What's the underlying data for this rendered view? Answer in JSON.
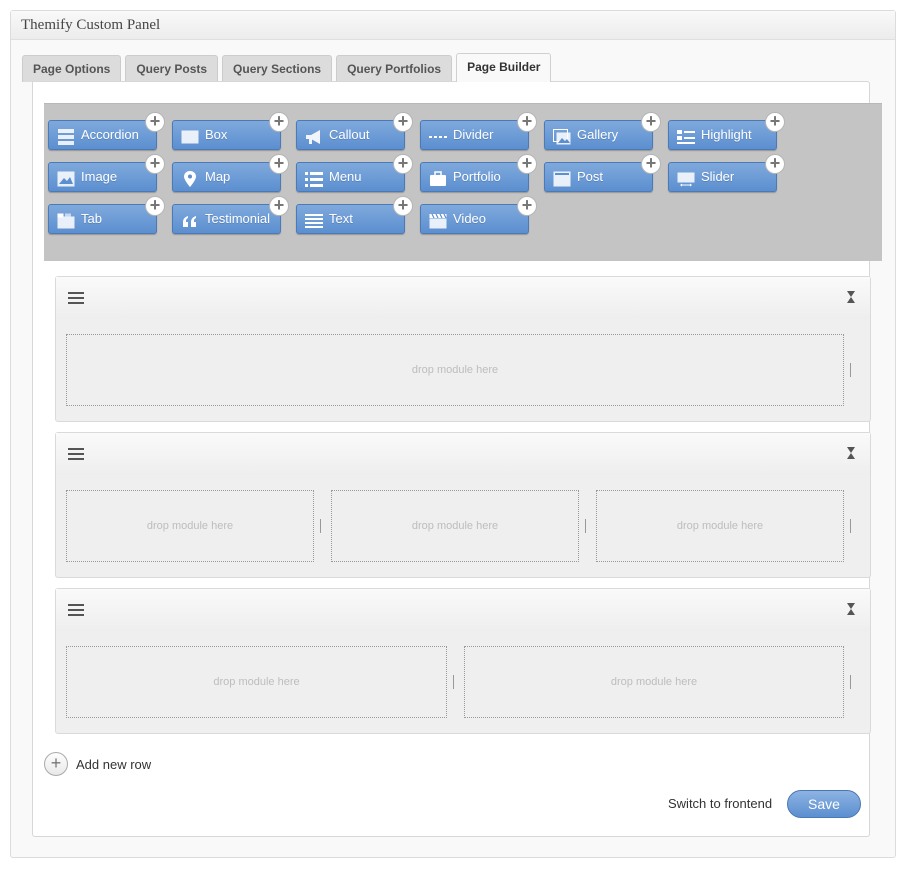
{
  "panel": {
    "title": "Themify Custom Panel"
  },
  "tabs": [
    {
      "label": "Page Options"
    },
    {
      "label": "Query Posts"
    },
    {
      "label": "Query Sections"
    },
    {
      "label": "Query Portfolios"
    },
    {
      "label": "Page Builder",
      "active": true
    }
  ],
  "modules": [
    {
      "label": "Accordion",
      "icon": "accordion-icon"
    },
    {
      "label": "Box",
      "icon": "box-icon"
    },
    {
      "label": "Callout",
      "icon": "megaphone-icon"
    },
    {
      "label": "Divider",
      "icon": "divider-icon"
    },
    {
      "label": "Gallery",
      "icon": "gallery-icon"
    },
    {
      "label": "Highlight",
      "icon": "highlight-icon"
    },
    {
      "label": "Image",
      "icon": "image-icon"
    },
    {
      "label": "Map",
      "icon": "map-pin-icon"
    },
    {
      "label": "Menu",
      "icon": "menu-list-icon"
    },
    {
      "label": "Portfolio",
      "icon": "briefcase-icon"
    },
    {
      "label": "Post",
      "icon": "post-icon"
    },
    {
      "label": "Slider",
      "icon": "slider-icon"
    },
    {
      "label": "Tab",
      "icon": "tab-icon"
    },
    {
      "label": "Testimonial",
      "icon": "quote-icon"
    },
    {
      "label": "Text",
      "icon": "text-lines-icon"
    },
    {
      "label": "Video",
      "icon": "clapperboard-icon"
    }
  ],
  "rows": [
    {
      "columns": [
        {
          "placeholder": "drop module here"
        }
      ]
    },
    {
      "columns": [
        {
          "placeholder": "drop module here"
        },
        {
          "placeholder": "drop module here"
        },
        {
          "placeholder": "drop module here"
        }
      ]
    },
    {
      "columns": [
        {
          "placeholder": "drop module here"
        },
        {
          "placeholder": "drop module here"
        }
      ]
    }
  ],
  "actions": {
    "add_row_label": "Add new row",
    "switch_label": "Switch to frontend",
    "save_label": "Save"
  },
  "colors": {
    "module_blue": "#5c8fd0",
    "module_area_bg": "#c4c4c4",
    "row_bg": "#efefef"
  }
}
